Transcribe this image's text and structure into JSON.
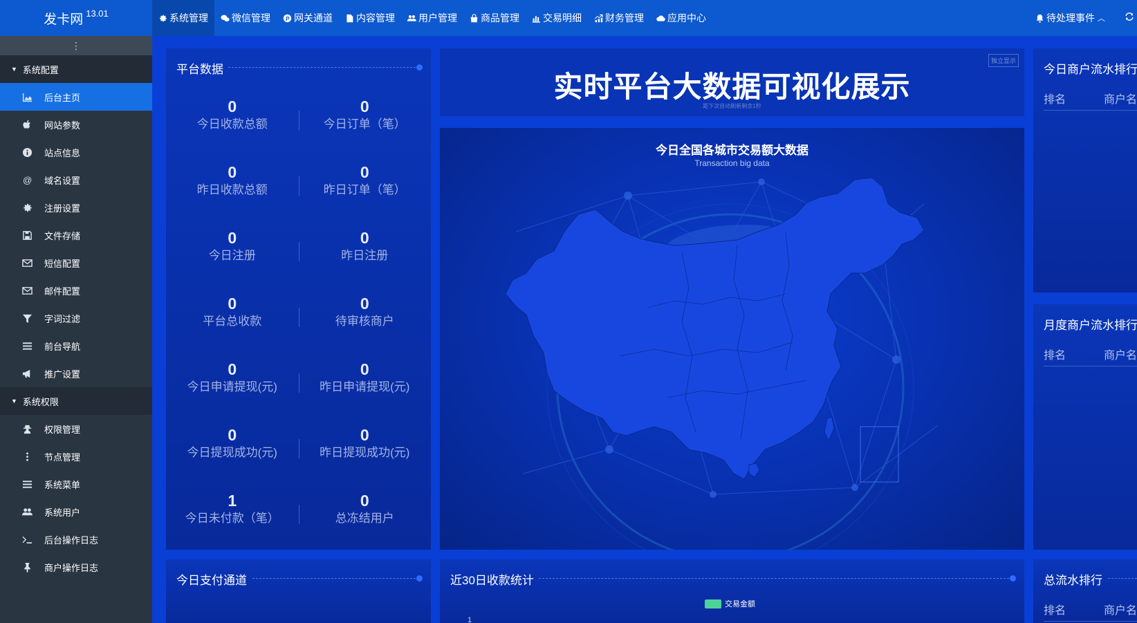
{
  "brand": {
    "name": "发卡网",
    "version": "13.01"
  },
  "topnav": [
    {
      "label": "系统管理",
      "icon": "gear-icon",
      "active": true
    },
    {
      "label": "微信管理",
      "icon": "wechat-icon",
      "active": false
    },
    {
      "label": "网关通道",
      "icon": "paypal-icon",
      "active": false
    },
    {
      "label": "内容管理",
      "icon": "file-icon",
      "active": false
    },
    {
      "label": "用户管理",
      "icon": "users-icon",
      "active": false
    },
    {
      "label": "商品管理",
      "icon": "bag-icon",
      "active": false
    },
    {
      "label": "交易明细",
      "icon": "bar-chart-icon",
      "active": false
    },
    {
      "label": "财务管理",
      "icon": "finance-icon",
      "active": false
    },
    {
      "label": "应用中心",
      "icon": "cloud-icon",
      "active": false
    }
  ],
  "topright": {
    "pending_label": "待处理事件"
  },
  "sidebar": {
    "groups": [
      {
        "label": "系统配置",
        "items": [
          {
            "label": "后台主页",
            "icon": "area-chart-icon",
            "active": true
          },
          {
            "label": "网站参数",
            "icon": "apple-icon"
          },
          {
            "label": "站点信息",
            "icon": "info-icon"
          },
          {
            "label": "域名设置",
            "icon": "at-icon"
          },
          {
            "label": "注册设置",
            "icon": "gear-icon"
          },
          {
            "label": "文件存储",
            "icon": "save-icon"
          },
          {
            "label": "短信配置",
            "icon": "envelope-icon"
          },
          {
            "label": "邮件配置",
            "icon": "envelope-icon"
          },
          {
            "label": "字词过滤",
            "icon": "filter-icon"
          },
          {
            "label": "前台导航",
            "icon": "bars-icon"
          },
          {
            "label": "推广设置",
            "icon": "bullhorn-icon"
          }
        ]
      },
      {
        "label": "系统权限",
        "items": [
          {
            "label": "权限管理",
            "icon": "user-secret-icon"
          },
          {
            "label": "节点管理",
            "icon": "ellipsis-icon"
          },
          {
            "label": "系统菜单",
            "icon": "bars-icon"
          },
          {
            "label": "系统用户",
            "icon": "users-icon"
          },
          {
            "label": "后台操作日志",
            "icon": "terminal-icon"
          },
          {
            "label": "商户操作日志",
            "icon": "pin-icon"
          }
        ]
      }
    ]
  },
  "platform": {
    "title": "平台数据",
    "stats": [
      {
        "value": "0",
        "label": "今日收款总额"
      },
      {
        "value": "0",
        "label": "今日订单（笔）"
      },
      {
        "value": "0",
        "label": "昨日收款总额"
      },
      {
        "value": "0",
        "label": "昨日订单（笔）"
      },
      {
        "value": "0",
        "label": "今日注册"
      },
      {
        "value": "0",
        "label": "昨日注册"
      },
      {
        "value": "0",
        "label": "平台总收款"
      },
      {
        "value": "0",
        "label": "待审核商户"
      },
      {
        "value": "0",
        "label": "今日申请提现(元)"
      },
      {
        "value": "0",
        "label": "昨日申请提现(元)"
      },
      {
        "value": "0",
        "label": "今日提现成功(元)"
      },
      {
        "value": "0",
        "label": "昨日提现成功(元)"
      },
      {
        "value": "1",
        "label": "今日未付款（笔）"
      },
      {
        "value": "0",
        "label": "总冻结用户"
      }
    ]
  },
  "header_panel": {
    "title": "实时平台大数据可视化展示",
    "subtitle": "距下次自动刷新剩余1秒",
    "button": "独立显示"
  },
  "map_panel": {
    "title": "今日全国各城市交易额大数据",
    "subtitle": "Transaction big data"
  },
  "ranking_today": {
    "title": "今日商户流水排行",
    "col_rank": "排名",
    "col_merchant": "商户名"
  },
  "ranking_month": {
    "title": "月度商户流水排行",
    "col_rank": "排名",
    "col_merchant": "商户名"
  },
  "ranking_total": {
    "title": "总流水排行",
    "col_rank": "排名",
    "col_merchant": "商户名"
  },
  "payment_channel": {
    "title": "今日支付通道"
  },
  "chart_panel": {
    "title": "近30日收款统计"
  },
  "chart_data": {
    "type": "bar",
    "title": "",
    "series": [
      {
        "name": "交易金额",
        "values": []
      }
    ],
    "y_ticks": [
      "1"
    ],
    "color": "#4dd39a"
  },
  "colors": {
    "accent": "#1670e4",
    "background": "#0a3fd6",
    "sidebar": "#2a3542",
    "topbar": "#0d59cf"
  }
}
